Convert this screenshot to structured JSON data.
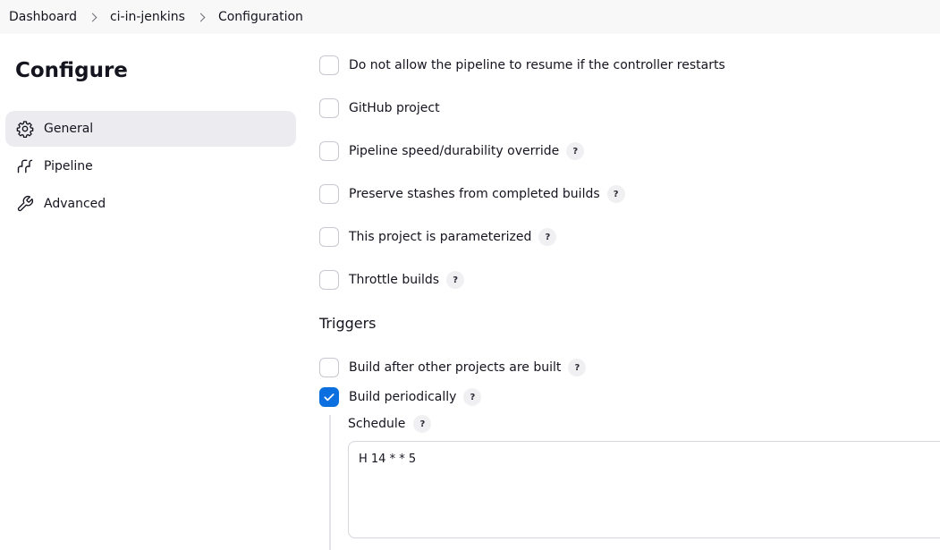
{
  "breadcrumb": [
    "Dashboard",
    "ci-in-jenkins",
    "Configuration"
  ],
  "page_title": "Configure",
  "sidebar": {
    "items": [
      {
        "label": "General",
        "icon": "gear-icon",
        "active": true
      },
      {
        "label": "Pipeline",
        "icon": "pipeline-icon",
        "active": false
      },
      {
        "label": "Advanced",
        "icon": "wrench-icon",
        "active": false
      }
    ]
  },
  "options": [
    {
      "label": "Do not allow the pipeline to resume if the controller restarts",
      "checked": false,
      "help": false
    },
    {
      "label": "GitHub project",
      "checked": false,
      "help": false
    },
    {
      "label": "Pipeline speed/durability override",
      "checked": false,
      "help": true
    },
    {
      "label": "Preserve stashes from completed builds",
      "checked": false,
      "help": true
    },
    {
      "label": "This project is parameterized",
      "checked": false,
      "help": true
    },
    {
      "label": "Throttle builds",
      "checked": false,
      "help": true
    }
  ],
  "triggers": {
    "heading": "Triggers",
    "options": [
      {
        "label": "Build after other projects are built",
        "checked": false,
        "help": true
      },
      {
        "label": "Build periodically",
        "checked": true,
        "help": true
      }
    ],
    "schedule": {
      "label": "Schedule",
      "value": "H 14 * * 5"
    }
  },
  "help_glyph": "?",
  "colors": {
    "accent": "#0b6fe0",
    "breadcrumb_bg": "#f8f8f9",
    "active_nav_bg": "#ececf0"
  }
}
